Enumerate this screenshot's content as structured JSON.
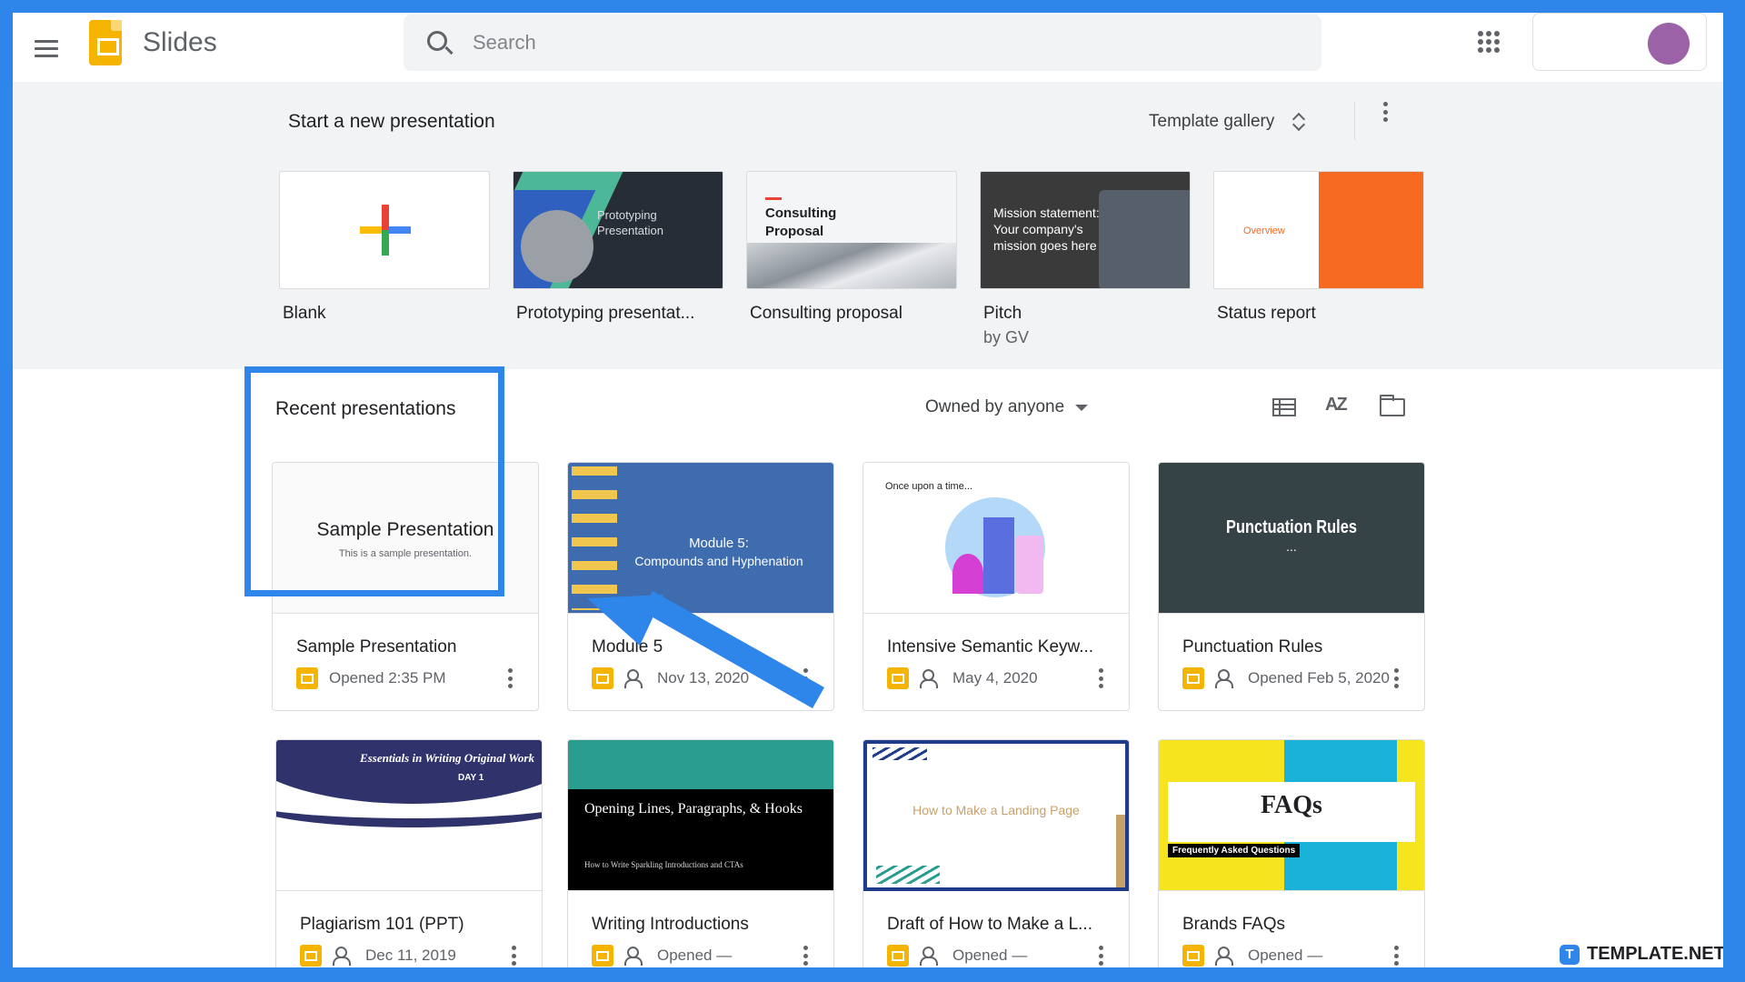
{
  "header": {
    "app_name": "Slides",
    "search_placeholder": "Search"
  },
  "new_section": {
    "title": "Start a new presentation",
    "gallery_label": "Template gallery",
    "templates": [
      {
        "name": "Blank"
      },
      {
        "name": "Prototyping presentat...",
        "thumb_text": "Prototyping Presentation"
      },
      {
        "name": "Consulting proposal",
        "thumb_text": "Consulting Proposal"
      },
      {
        "name": "Pitch",
        "sub": "by GV",
        "thumb_text": "Mission statement: Your company's mission goes here"
      },
      {
        "name": "Status report",
        "thumb_text": "Overview"
      }
    ]
  },
  "recent": {
    "title": "Recent presentations",
    "owner_filter": "Owned by anyone",
    "cards": [
      {
        "title": "Sample Presentation",
        "meta": "Opened 2:35 PM",
        "shared": false,
        "thumb_title": "Sample Presentation",
        "thumb_sub": "This is a sample presentation."
      },
      {
        "title": "Module 5",
        "meta": "Nov 13, 2020",
        "shared": true,
        "thumb_title": "Module 5:",
        "thumb_sub": "Compounds and Hyphenation"
      },
      {
        "title": "Intensive Semantic Keyw...",
        "meta": "May 4, 2020",
        "shared": true,
        "thumb_title": "Once upon a time..."
      },
      {
        "title": "Punctuation Rules",
        "meta": "Opened Feb 5, 2020",
        "shared": true,
        "thumb_title": "Punctuation Rules"
      },
      {
        "title": "Plagiarism 101 (PPT)",
        "meta": "Dec 11, 2019",
        "shared": true,
        "thumb_title": "Essentials in Writing Original Work",
        "thumb_sub": "DAY 1"
      },
      {
        "title": "Writing Introductions",
        "meta": "Opened —",
        "shared": true,
        "thumb_title": "Opening Lines, Paragraphs, & Hooks",
        "thumb_sub": "How to Write Sparkling Introductions and CTAs"
      },
      {
        "title": "Draft of How to Make a L...",
        "meta": "Opened —",
        "shared": true,
        "thumb_title": "How to Make a Landing Page"
      },
      {
        "title": "Brands FAQs",
        "meta": "Opened —",
        "shared": true,
        "thumb_title": "FAQs",
        "thumb_sub": "Frequently Asked Questions"
      }
    ]
  },
  "watermark": "TEMPLATE.NET",
  "colors": {
    "border_frame": "#2f86ea",
    "slides_yellow": "#f4b400",
    "avatar": "#9c62a8"
  }
}
